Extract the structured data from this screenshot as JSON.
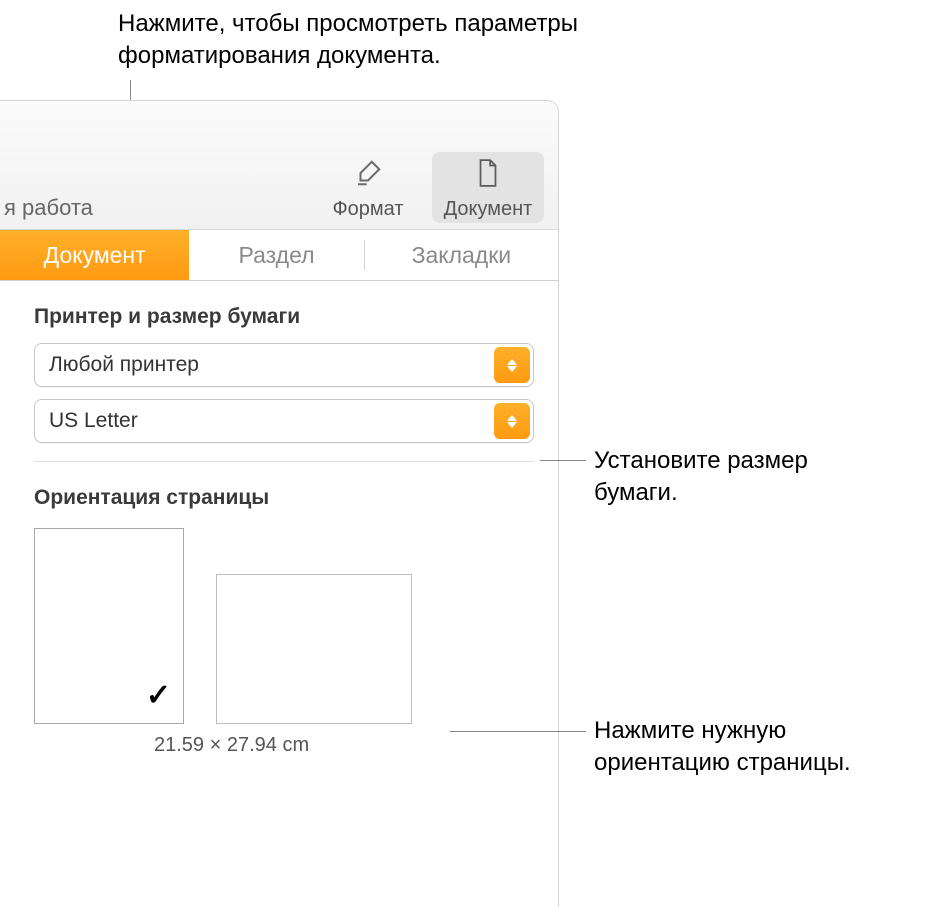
{
  "callouts": {
    "top": "Нажмите, чтобы просмотреть параметры форматирования документа.",
    "paper": "Установите размер бумаги.",
    "orientation": "Нажмите нужную ориентацию страницы."
  },
  "toolbar": {
    "left_fragment": "я работа",
    "format_label": "Формат",
    "document_label": "Документ"
  },
  "tabs": {
    "document": "Документ",
    "section": "Раздел",
    "bookmarks": "Закладки"
  },
  "panel": {
    "printer_section_title": "Принтер и размер бумаги",
    "printer_value": "Любой принтер",
    "paper_value": "US Letter",
    "orientation_title": "Ориентация страницы",
    "dimensions": "21.59 × 27.94 cm",
    "checkmark": "✓"
  }
}
